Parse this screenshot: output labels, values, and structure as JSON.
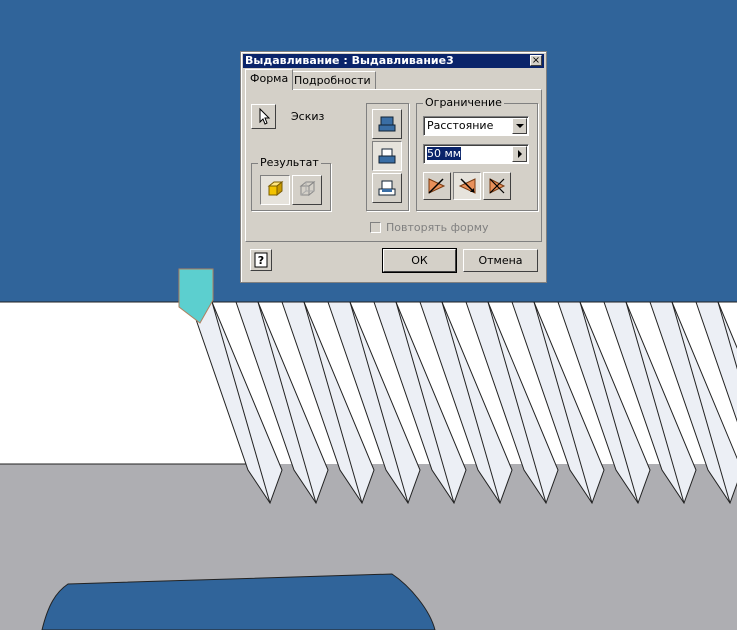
{
  "colors": {
    "viewport_background": "#30649a",
    "part_face_white": "#ffffff",
    "part_face_grey": "#aeaeb2",
    "thread_face": "#eceff5",
    "marker_cyan": "#5ccfcf",
    "dialog_face": "#d4d0c8",
    "titlebar": "#0a246a",
    "accent_orange": "#e8905a"
  },
  "dialog": {
    "title": "Выдавливание : Выдавливание3",
    "close_glyph": "×",
    "tabs": [
      {
        "label": "Форма",
        "active": true
      },
      {
        "label": "Подробности",
        "active": false
      }
    ],
    "sketch_label": "Эскиз",
    "result_group_label": "Результат",
    "extent_group_label": "Ограничение",
    "extent_type_value": "Расстояние",
    "distance_value": "50 мм",
    "repeat_shape_label": "Повторять форму",
    "repeat_shape_checked": false,
    "ok_label": "ОК",
    "cancel_label": "Отмена",
    "help_glyph": "?"
  },
  "icons": {
    "select_sketch": "arrow-cursor-icon",
    "result_solid": "solid-cube-icon",
    "result_surface": "surface-cube-icon",
    "operation_join": "join-icon",
    "operation_cut": "cut-icon",
    "operation_intersect": "intersect-icon",
    "direction_1": "direction-one-icon",
    "direction_2": "direction-two-icon",
    "direction_symmetric": "direction-symmetric-icon",
    "help": "help-icon"
  }
}
